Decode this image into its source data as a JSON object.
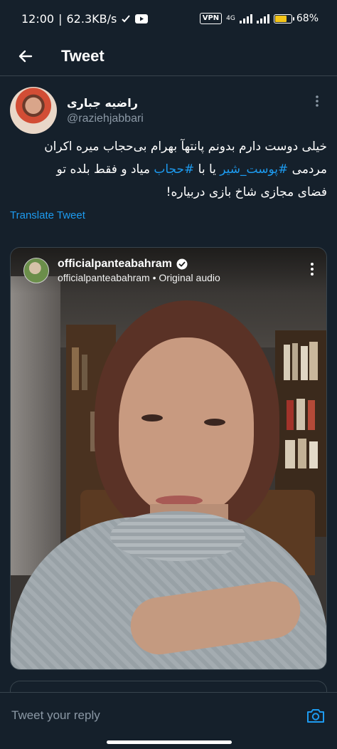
{
  "status_bar": {
    "time": "12:00",
    "speed": "62.3KB/s",
    "vpn": "VPN",
    "network": "4G",
    "battery": "68%",
    "battery_level": 0.68
  },
  "header": {
    "title": "Tweet",
    "back_icon": "arrow-left-icon"
  },
  "tweet": {
    "author_name": "راضیه جباری",
    "author_handle": "@raziehjabbari",
    "text_line1": "خیلی دوست دارم بدونم پانتهآ بهرام بی‌حجاب میره اکران",
    "text_line2_prefix": "مردمی ",
    "hashtag1": "#پوست_شیر",
    "text_line2_mid": " یا با ",
    "hashtag2": "#حجاب",
    "text_line2_suffix": " میاد و فقط بلده تو",
    "text_line3": "فضای مجازی شاخ بازی دربیاره!",
    "translate_label": "Translate Tweet"
  },
  "media": {
    "ig_username": "officialpanteabahram",
    "ig_subtitle": "officialpanteabahram • Original audio"
  },
  "reply": {
    "placeholder": "Tweet your reply"
  },
  "colors": {
    "background": "#15202b",
    "accent": "#1d9bf0",
    "secondary_text": "#8b98a5",
    "border": "#38444d"
  }
}
